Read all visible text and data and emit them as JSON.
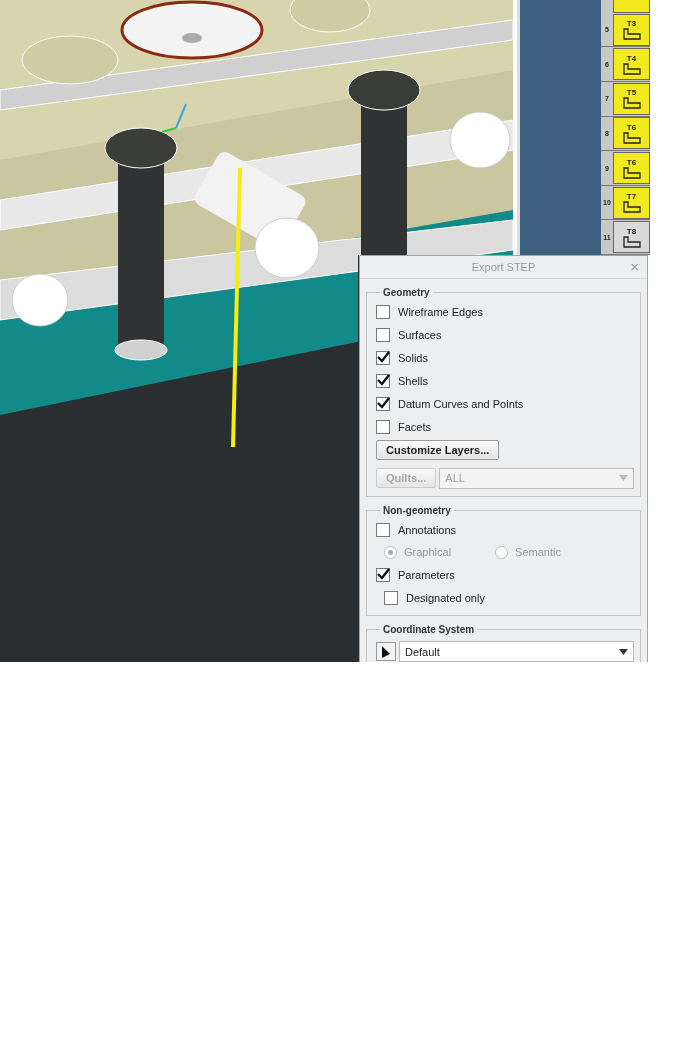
{
  "tool_tabs": [
    {
      "number": "5",
      "label": "T3",
      "color": "#f2ea1e"
    },
    {
      "number": "6",
      "label": "T4",
      "color": "#f2ea1e"
    },
    {
      "number": "7",
      "label": "T5",
      "color": "#f2ea1e"
    },
    {
      "number": "8",
      "label": "T6",
      "color": "#f2ea1e"
    },
    {
      "number": "9",
      "label": "T6",
      "color": "#f2ea1e"
    },
    {
      "number": "10",
      "label": "T7",
      "color": "#f2ea1e"
    },
    {
      "number": "11",
      "label": "T8",
      "color": "#d9d9d9"
    }
  ],
  "dialog": {
    "title": "Export STEP",
    "close": "×",
    "geometry": {
      "legend": "Geometry",
      "options": [
        {
          "label": "Wireframe Edges",
          "checked": false
        },
        {
          "label": "Surfaces",
          "checked": false
        },
        {
          "label": "Solids",
          "checked": true
        },
        {
          "label": "Shells",
          "checked": true
        },
        {
          "label": "Datum Curves and Points",
          "checked": true
        },
        {
          "label": "Facets",
          "checked": false
        }
      ],
      "customize_button": "Customize Layers...",
      "quilts_button": {
        "label": "Quilts...",
        "disabled": true
      },
      "quilts_select": {
        "value": "ALL",
        "disabled": true
      }
    },
    "non_geometry": {
      "legend": "Non-geometry",
      "annotations": {
        "label": "Annotations",
        "checked": false
      },
      "representation_disabled": true,
      "representation": [
        {
          "label": "Graphical",
          "selected": true
        },
        {
          "label": "Semantic",
          "selected": false
        }
      ],
      "parameters": {
        "label": "Parameters",
        "checked": true
      },
      "designated_only": {
        "label": "Designated only",
        "checked": false
      }
    },
    "coordinate_system": {
      "legend": "Coordinate System",
      "value": "Default"
    }
  }
}
